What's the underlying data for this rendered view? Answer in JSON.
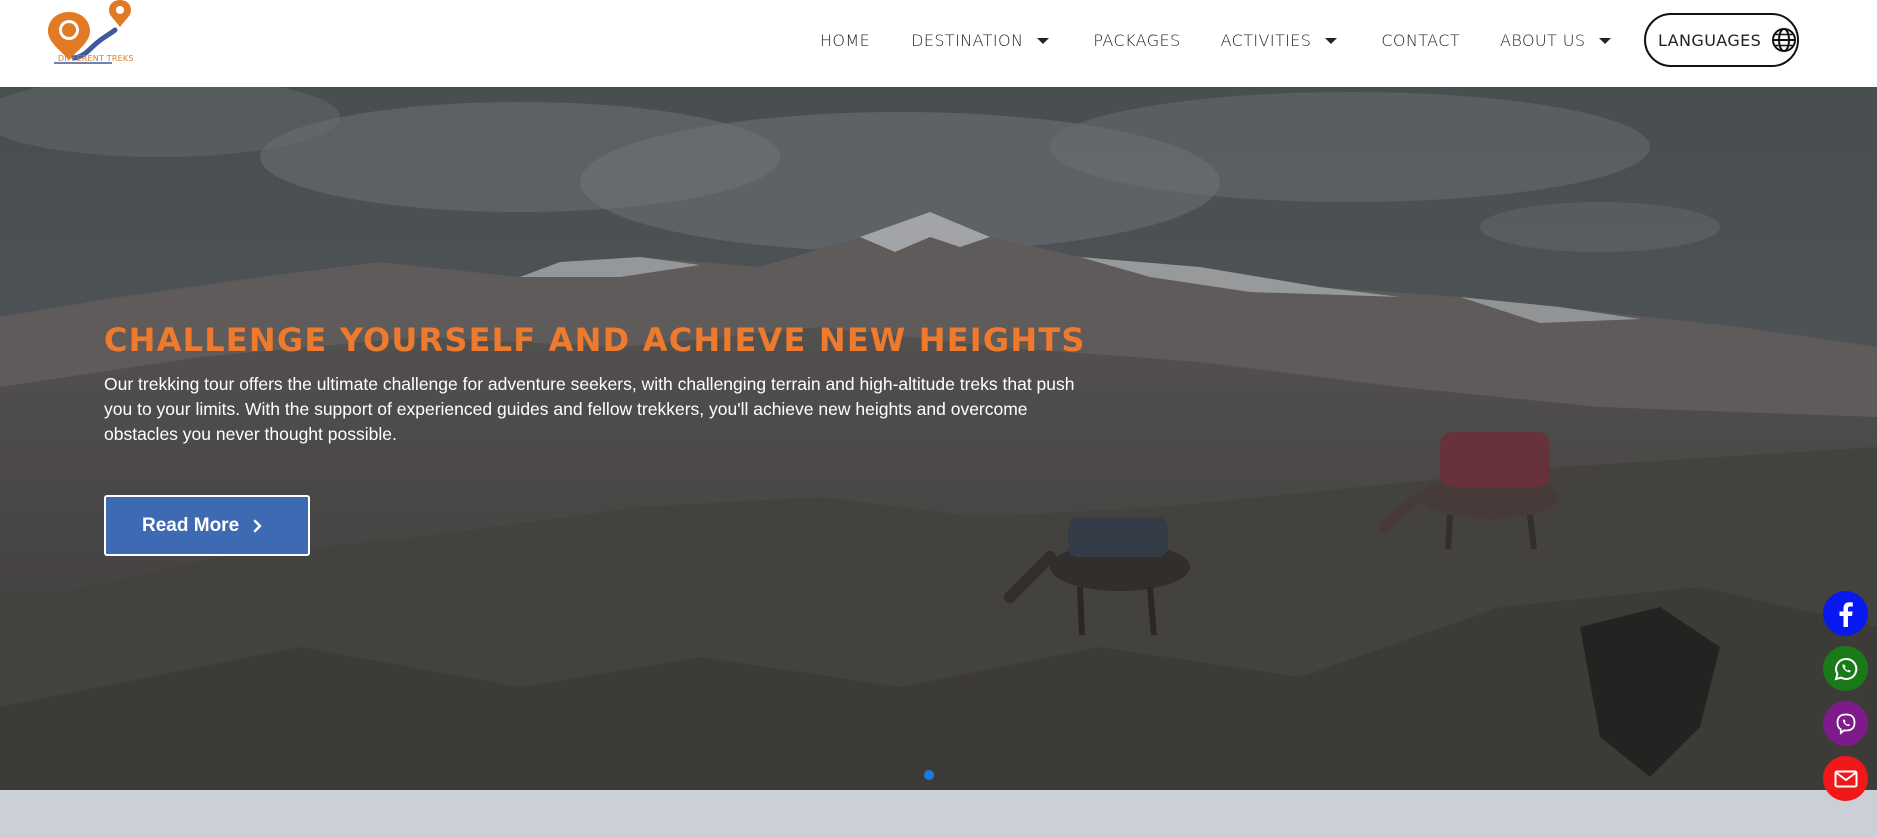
{
  "brand": {
    "logo_text": "DIFFERENT TREKS",
    "primary_color": "#e07a24",
    "secondary_color": "#3e5a9a"
  },
  "nav": {
    "items": [
      {
        "label": "HOME",
        "has_dropdown": false
      },
      {
        "label": "DESTINATION",
        "has_dropdown": true
      },
      {
        "label": "PACKAGES",
        "has_dropdown": false
      },
      {
        "label": "ACTIVITIES",
        "has_dropdown": true
      },
      {
        "label": "CONTACT",
        "has_dropdown": false
      },
      {
        "label": "ABOUT US",
        "has_dropdown": true
      }
    ],
    "languages_label": "LANGUAGES",
    "languages_icon": "globe-icon"
  },
  "hero": {
    "title": "CHALLENGE YOURSELF AND ACHIEVE NEW HEIGHTS",
    "text": "Our trekking tour offers the ultimate challenge for adventure seekers, with challenging terrain and high-altitude treks that push you to your limits. With the support of experienced guides and fellow trekkers, you'll achieve new heights and overcome obstacles you never thought possible.",
    "button_label": "Read More",
    "title_color": "#ef7a2d",
    "button_color": "#3e6ab3",
    "slide_count": 1,
    "active_slide": 1
  },
  "social": [
    {
      "name": "facebook",
      "icon": "facebook-icon",
      "color": "#0a18f0"
    },
    {
      "name": "whatsapp",
      "icon": "whatsapp-icon",
      "color": "#1a7a1a"
    },
    {
      "name": "viber",
      "icon": "viber-icon",
      "color": "#7d1b8a"
    },
    {
      "name": "email",
      "icon": "mail-icon",
      "color": "#f01818"
    }
  ]
}
